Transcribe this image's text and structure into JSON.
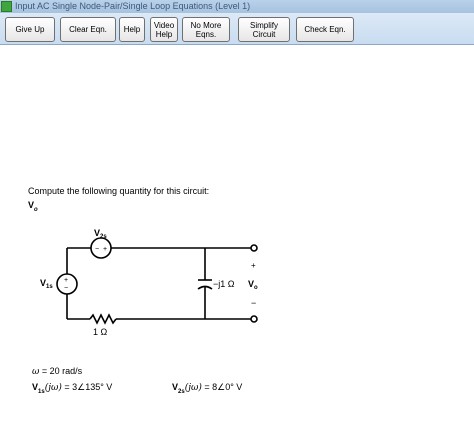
{
  "window": {
    "title": "Input AC Single Node-Pair/Single Loop Equations (Level 1)"
  },
  "toolbar": {
    "give_up": "Give Up",
    "clear_eqn": "Clear Eqn.",
    "help": "Help",
    "video_help": "Video\nHelp",
    "no_more_eqns": "No More\nEqns.",
    "simplify_circuit": "Simplify\nCircuit",
    "check_eqn": "Check Eqn."
  },
  "problem": {
    "prompt": "Compute the following quantity for this circuit:",
    "quantity_main": "V",
    "quantity_sub": "o"
  },
  "circuit": {
    "source1_label": "V",
    "source1_sub": "1s",
    "source2_label": "V",
    "source2_sub": "2s",
    "resistor_label": "1 Ω",
    "capacitor_label": "−j1 Ω",
    "output_label": "V",
    "output_sub": "o",
    "plus_sign": "+",
    "minus_sign": "−"
  },
  "given": {
    "omega_symbol": "ω",
    "omega_value": " = 20 rad/s",
    "source1_name": "V",
    "source1_sub": "1s",
    "source1_arg": "(jω)",
    "source1_value": " = 3∠135° V",
    "source2_name": "V",
    "source2_sub": "2s",
    "source2_arg": "(jω)",
    "source2_value": " = 8∠0° V"
  }
}
